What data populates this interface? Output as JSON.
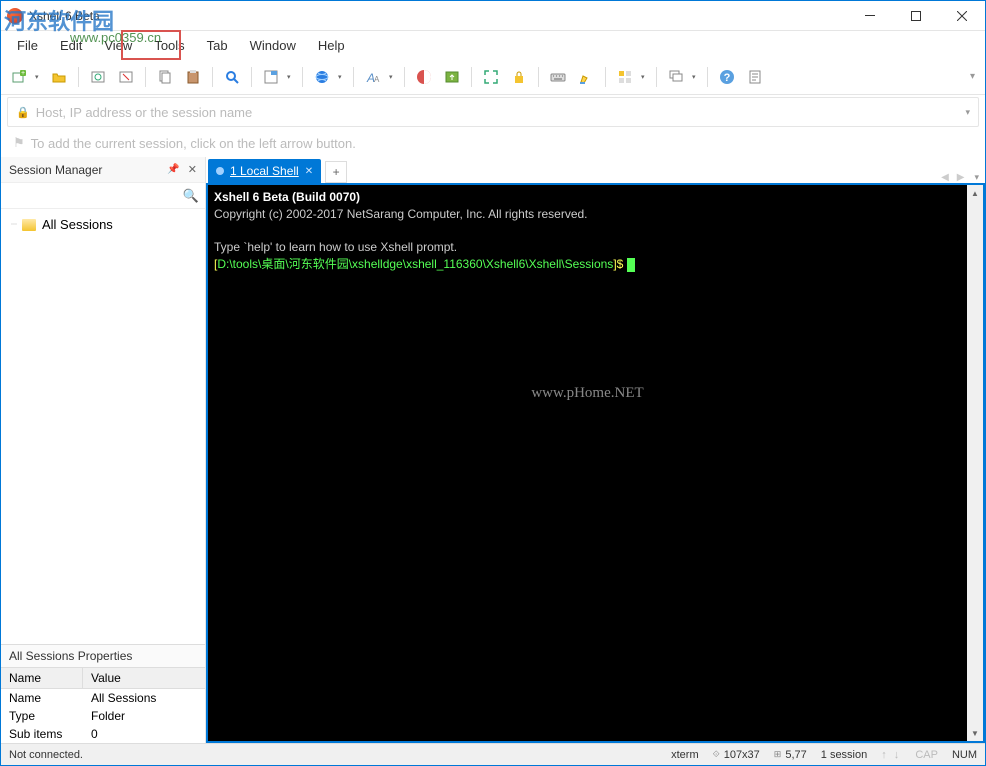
{
  "window": {
    "title": "Xshell 6 Beta"
  },
  "watermark": {
    "top": "河东软件园",
    "sub": "www.pc0359.cn",
    "term": "www.pHome.NET"
  },
  "menu": {
    "file": "File",
    "edit": "Edit",
    "view": "View",
    "tools": "Tools",
    "tab": "Tab",
    "window": "Window",
    "help": "Help"
  },
  "address": {
    "placeholder": "Host, IP address or the session name"
  },
  "hint": {
    "text": "To add the current session, click on the left arrow button."
  },
  "sidebar": {
    "title": "Session Manager",
    "search_placeholder": "",
    "root": "All Sessions",
    "props_title": "All Sessions Properties",
    "col_name": "Name",
    "col_value": "Value",
    "rows": {
      "name_k": "Name",
      "name_v": "All Sessions",
      "type_k": "Type",
      "type_v": "Folder",
      "sub_k": "Sub items",
      "sub_v": "0"
    }
  },
  "tabs": {
    "active": "1 Local Shell"
  },
  "terminal": {
    "line1": "Xshell 6 Beta (Build 0070)",
    "line2": "Copyright (c) 2002-2017 NetSarang Computer, Inc. All rights reserved.",
    "line3": "Type `help' to learn how to use Xshell prompt.",
    "prompt_bracket_open": "[",
    "prompt_path": "D:\\tools\\桌面\\河东软件园\\xshelldge\\xshell_116360\\Xshell6\\Xshell\\Sessions",
    "prompt_bracket_close": "]$ "
  },
  "status": {
    "left": "Not connected.",
    "term_type": "xterm",
    "size": "107x37",
    "pos": "5,77",
    "sessions": "1 session",
    "cap": "CAP",
    "num": "NUM"
  }
}
